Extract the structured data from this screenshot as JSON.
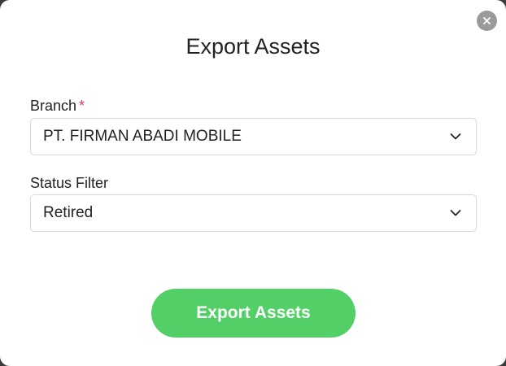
{
  "dialog": {
    "title": "Export Assets",
    "close_icon": "close-icon"
  },
  "branch": {
    "label": "Branch",
    "required_mark": "*",
    "value": "PT. FIRMAN ABADI MOBILE",
    "icon": "chevron-down-icon"
  },
  "status_filter": {
    "label": "Status Filter",
    "value": "Retired",
    "icon": "chevron-down-icon"
  },
  "actions": {
    "export_label": "Export Assets"
  },
  "colors": {
    "primary_button": "#52cf66",
    "required": "#e8336a",
    "close_button": "#9a9a9a"
  }
}
